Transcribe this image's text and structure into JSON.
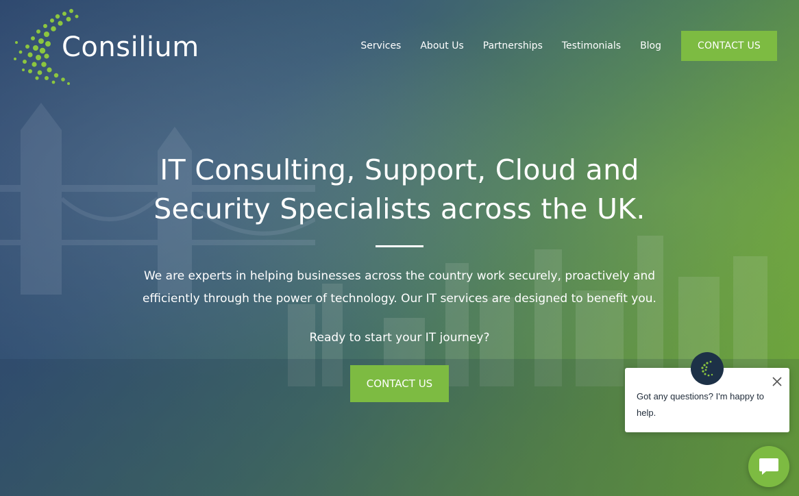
{
  "header": {
    "logo_text": "Consilium",
    "nav": [
      {
        "label": "Services"
      },
      {
        "label": "About Us"
      },
      {
        "label": "Partnerships"
      },
      {
        "label": "Testimonials"
      },
      {
        "label": "Blog"
      }
    ],
    "cta_label": "CONTACT US"
  },
  "hero": {
    "title_line1": "IT Consulting, Support, Cloud and",
    "title_line2": "Security Specialists across the UK.",
    "subtitle_line1": "We are experts in helping businesses across the country work securely, proactively and",
    "subtitle_line2": "efficiently through the power of technology. Our IT services are designed to benefit you.",
    "ready_text": "Ready to start your IT journey?",
    "cta_label": "CONTACT US"
  },
  "chat": {
    "message": "Got any questions? I'm happy to help.",
    "avatar_icon": "consilium-logo-icon",
    "close_icon": "close-icon",
    "launcher_icon": "chat-bubble-icon"
  },
  "colors": {
    "accent": "#7dbb42",
    "chat_avatar_bg": "#1d3147",
    "text_light": "#ffffff"
  }
}
